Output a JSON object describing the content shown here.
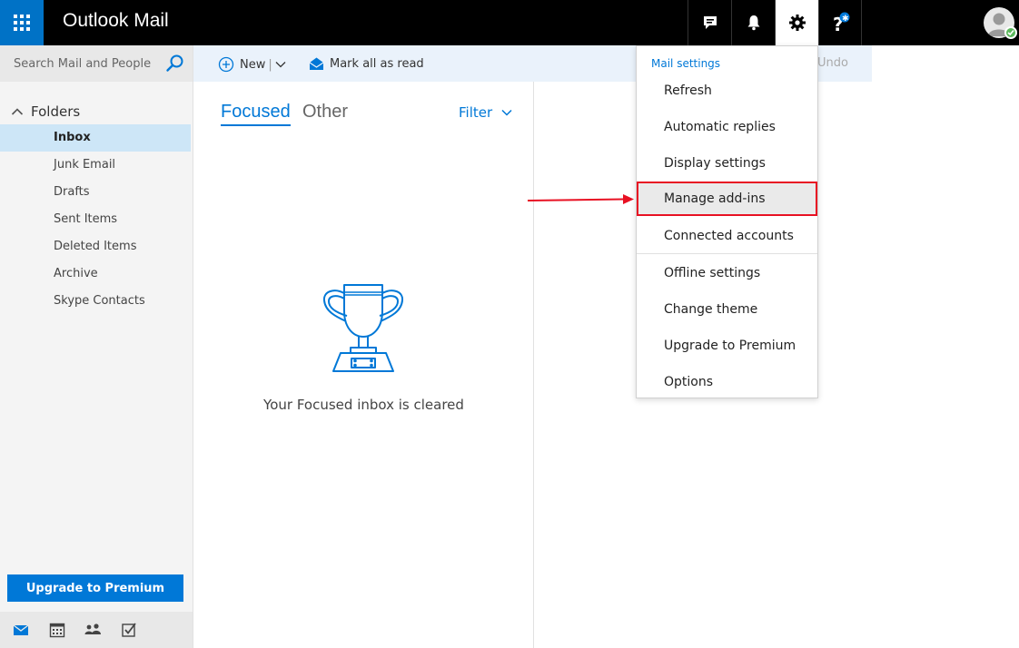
{
  "app": {
    "title": "Outlook Mail"
  },
  "search": {
    "placeholder": "Search Mail and People"
  },
  "folders": {
    "heading": "Folders",
    "items": [
      {
        "label": "Inbox",
        "selected": true
      },
      {
        "label": "Junk Email"
      },
      {
        "label": "Drafts"
      },
      {
        "label": "Sent Items"
      },
      {
        "label": "Deleted Items"
      },
      {
        "label": "Archive"
      },
      {
        "label": "Skype Contacts"
      }
    ]
  },
  "upgrade": {
    "label": "Upgrade to Premium"
  },
  "toolbar": {
    "new_label": "New",
    "mark_read_label": "Mark all as read",
    "undo_label": "Undo"
  },
  "message_list": {
    "tabs": [
      {
        "label": "Focused",
        "active": true
      },
      {
        "label": "Other"
      }
    ],
    "filter_label": "Filter",
    "empty_message": "Your Focused inbox is cleared"
  },
  "settings_menu": {
    "heading": "Mail settings",
    "items": [
      {
        "label": "Refresh"
      },
      {
        "label": "Automatic replies"
      },
      {
        "label": "Display settings"
      },
      {
        "label": "Manage add-ins",
        "highlighted": true
      },
      {
        "label": "Connected accounts"
      },
      {
        "label": "Offline settings"
      },
      {
        "label": "Change theme"
      },
      {
        "label": "Upgrade to Premium"
      },
      {
        "label": "Options"
      }
    ]
  },
  "topbar_icons": [
    "chat-icon",
    "bell-icon",
    "gear-icon",
    "help-icon"
  ],
  "colors": {
    "accent": "#0078d7",
    "brand": "#0072c6",
    "highlight_border": "#e81123",
    "selected_folder": "#cde6f7"
  }
}
